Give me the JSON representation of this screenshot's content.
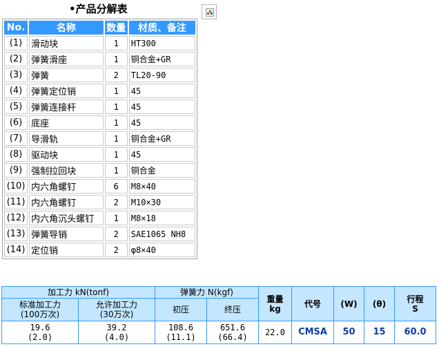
{
  "parts_table": {
    "title": "•产品分解表",
    "headers": [
      "No.",
      "名称",
      "数量",
      "材质、备注"
    ],
    "rows": [
      {
        "no": "(1)",
        "name": "滑动块",
        "qty": "1",
        "material": "HT300"
      },
      {
        "no": "(2)",
        "name": "弹簧滑座",
        "qty": "1",
        "material": "铜合金+GR"
      },
      {
        "no": "(3)",
        "name": "弹簧",
        "qty": "2",
        "material": "TL20-90"
      },
      {
        "no": "(4)",
        "name": "弹簧定位销",
        "qty": "1",
        "material": "45"
      },
      {
        "no": "(5)",
        "name": "弹簧连接杆",
        "qty": "1",
        "material": "45"
      },
      {
        "no": "(6)",
        "name": "底座",
        "qty": "1",
        "material": "45"
      },
      {
        "no": "(7)",
        "name": "导滑轨",
        "qty": "1",
        "material": "铜合金+GR"
      },
      {
        "no": "(8)",
        "name": "驱动块",
        "qty": "1",
        "material": "45"
      },
      {
        "no": "(9)",
        "name": "强制拉回块",
        "qty": "1",
        "material": "铜合金"
      },
      {
        "no": "(10)",
        "name": "内六角螺钉",
        "qty": "6",
        "material": "M8×40"
      },
      {
        "no": "(11)",
        "name": "内六角螺钉",
        "qty": "2",
        "material": "M10×30"
      },
      {
        "no": "(12)",
        "name": "内六角沉头螺钉",
        "qty": "1",
        "material": "M8×18"
      },
      {
        "no": "(13)",
        "name": "弹簧导销",
        "qty": "2",
        "material": "SAE1065 NH8"
      },
      {
        "no": "(14)",
        "name": "定位销",
        "qty": "2",
        "material": "φ8×40"
      }
    ]
  },
  "image_placeholder_icon": "broken-image-icon",
  "spec_table": {
    "header_top": {
      "processing_force": "加工力 kN(tonf)",
      "spring_force": "弹簧力 N(kgf)",
      "weight": "重量 kg",
      "code": "代号",
      "w": "(W)",
      "theta": "(θ)",
      "stroke": "行程 S"
    },
    "header_sub": {
      "standard_force": "标准加工力 (100万次)",
      "allowed_force": "允许加工力 (30万次)",
      "initial_pressure": "初压",
      "final_pressure": "终压"
    },
    "row": {
      "standard_force": "19.6 (2.0)",
      "allowed_force": "39.2 (4.0)",
      "initial_pressure": "108.6 (11.1)",
      "final_pressure": "651.6 (66.4)",
      "weight": "22.0",
      "code": "CMSA",
      "w": "50",
      "theta": "15",
      "stroke": "60.0"
    }
  },
  "colors": {
    "header_blue": "#3399ff",
    "spec_header_bg": "#c4e6ff",
    "spec_value_blue": "#0b3fa8"
  }
}
